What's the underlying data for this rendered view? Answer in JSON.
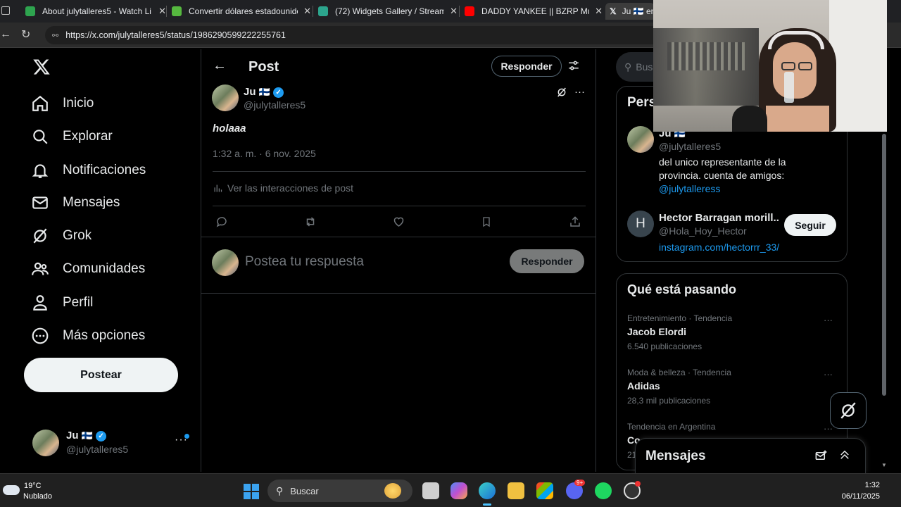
{
  "browser": {
    "tabs": [
      {
        "title": "About julytalleres5 - Watch Li",
        "favicon_color": "#2ea44f"
      },
      {
        "title": "Convertir dólares estadounide",
        "favicon_color": "#56b83f"
      },
      {
        "title": "(72) Widgets Gallery / Streaml",
        "favicon_color": "#2ca58d"
      },
      {
        "title": "DADDY YANKEE || BZRP Music",
        "favicon_color": "#ff0000"
      },
      {
        "title": "Ju 🇫🇮 en",
        "favicon_color": "#ffffff"
      }
    ],
    "url": "https://x.com/julytalleres5/status/1986290599222255761"
  },
  "nav": {
    "items": [
      {
        "label": "Inicio",
        "icon": "home-icon"
      },
      {
        "label": "Explorar",
        "icon": "search-icon"
      },
      {
        "label": "Notificaciones",
        "icon": "bell-icon"
      },
      {
        "label": "Mensajes",
        "icon": "mail-icon"
      },
      {
        "label": "Grok",
        "icon": "grok-icon"
      },
      {
        "label": "Comunidades",
        "icon": "people-icon"
      },
      {
        "label": "Perfil",
        "icon": "person-icon"
      },
      {
        "label": "Más opciones",
        "icon": "more-circle-icon"
      }
    ],
    "post_button": "Postear",
    "account": {
      "name": "Ju",
      "flag": "🇫🇮",
      "handle": "@julytalleres5"
    }
  },
  "header": {
    "title": "Post",
    "reply_button": "Responder"
  },
  "post": {
    "author_name": "Ju",
    "author_flag": "🇫🇮",
    "author_handle": "@julytalleres5",
    "text": "holaaa",
    "timestamp": "1:32 a. m. · 6 nov. 2025",
    "analytics_link": "Ver las interacciones de post"
  },
  "reply_box": {
    "placeholder": "Postea tu respuesta",
    "button": "Responder"
  },
  "right": {
    "search_placeholder": "Bus",
    "who_to_follow_title": "Pers",
    "profile_card": {
      "name": "Ju",
      "flag": "🇫🇮",
      "handle": "@julytalleres5",
      "bio": "del unico representante de la provincia. cuenta de amigos:",
      "bio_link": "@julytalleress"
    },
    "suggestion": {
      "initial": "H",
      "name": "Hector Barragan morill...",
      "handle": "@Hola_Hoy_Hector",
      "link": "instagram.com/hectorrr_33/",
      "follow": "Seguir"
    },
    "trending": {
      "title": "Qué está pasando",
      "items": [
        {
          "context": "Entretenimiento · Tendencia",
          "topic": "Jacob Elordi",
          "count": "6.540 publicaciones"
        },
        {
          "context": "Moda & belleza · Tendencia",
          "topic": "Adidas",
          "count": "28,3 mil publicaciones"
        },
        {
          "context": "Tendencia en Argentina",
          "topic": "Co..",
          "count": "21"
        }
      ]
    },
    "messages_drawer": "Mensajes"
  },
  "taskbar": {
    "weather_temp": "19°C",
    "weather_desc": "Nublado",
    "search": "Buscar",
    "time": "1:32",
    "date": "06/11/2025",
    "discord_badge": "9+"
  }
}
